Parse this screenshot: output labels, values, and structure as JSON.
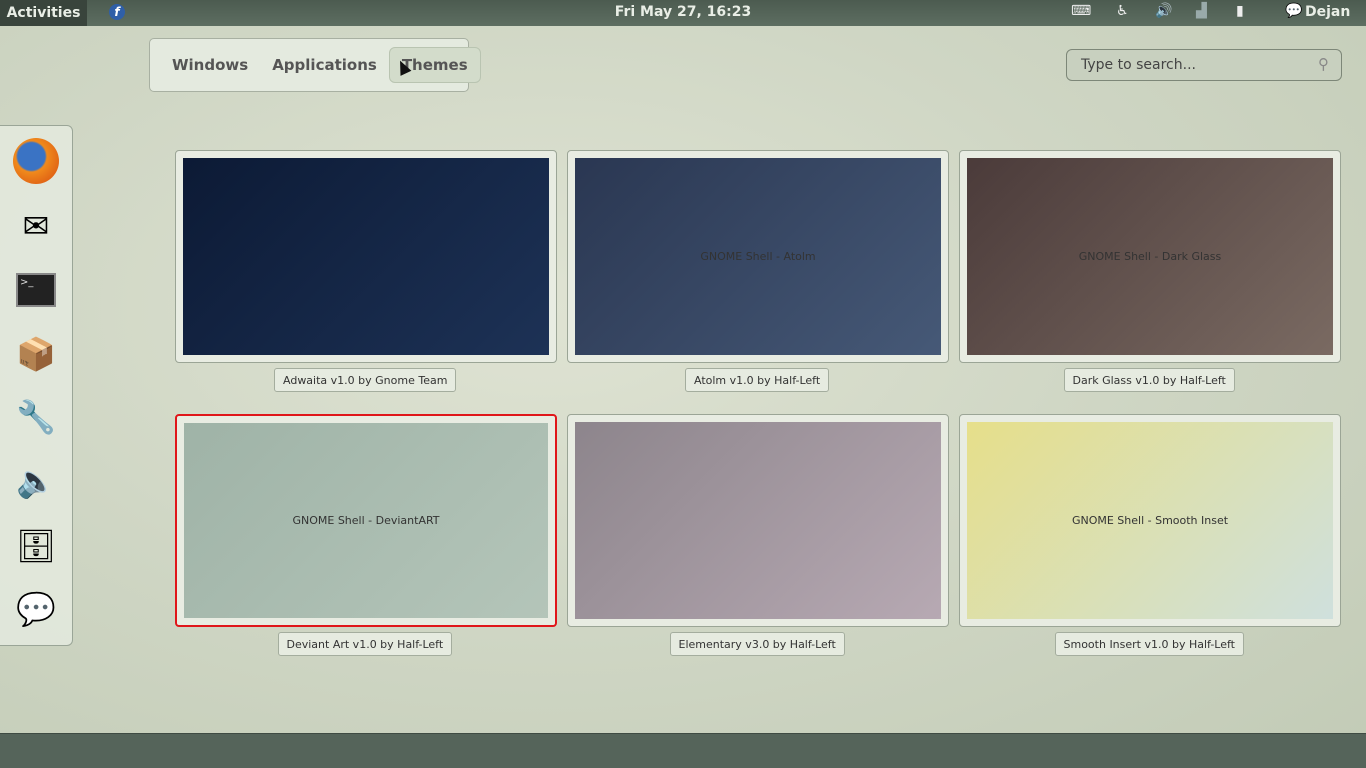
{
  "topbar": {
    "activities": "Activities",
    "clock": "Fri May 27, 16:23",
    "user": "Dejan",
    "tray_icons": [
      "keyboard-icon",
      "accessibility-icon",
      "volume-icon",
      "network-signal-icon",
      "battery-icon",
      "chat-status-icon"
    ]
  },
  "view_tabs": [
    {
      "label": "Windows"
    },
    {
      "label": "Applications"
    },
    {
      "label": "Themes",
      "active": true
    }
  ],
  "search": {
    "placeholder": "Type to search..."
  },
  "dash": [
    "firefox-icon",
    "mail-clock-icon",
    "terminal-icon",
    "package-icon",
    "settings-tools-icon",
    "speaker-icon",
    "file-cabinet-icon",
    "pidgin-chat-icon"
  ],
  "themes": [
    {
      "label": "Adwaita v1.0 by Gnome Team",
      "preview_text": "",
      "selected": false,
      "colors": [
        "#0c1a35",
        "#1d3256"
      ]
    },
    {
      "label": "Atolm v1.0 by Half-Left",
      "preview_text": "GNOME Shell - Atolm",
      "selected": false,
      "colors": [
        "#2a3752",
        "#465977"
      ]
    },
    {
      "label": "Dark Glass v1.0 by Half-Left",
      "preview_text": "GNOME Shell - Dark Glass",
      "selected": false,
      "colors": [
        "#4b3b3a",
        "#7a6a62"
      ]
    },
    {
      "label": "Deviant Art v1.0 by Half-Left",
      "preview_text": "GNOME Shell - DeviantART",
      "selected": true,
      "colors": [
        "#9fb3a7",
        "#b4c5b9"
      ]
    },
    {
      "label": "Elementary v3.0 by Half-Left",
      "preview_text": "",
      "selected": false,
      "colors": [
        "#8d858c",
        "#b7a9b3"
      ]
    },
    {
      "label": "Smooth Insert v1.0 by Half-Left",
      "preview_text": "GNOME Shell - Smooth Inset",
      "selected": false,
      "colors": [
        "#e6df8a",
        "#cfe0dd"
      ]
    }
  ]
}
